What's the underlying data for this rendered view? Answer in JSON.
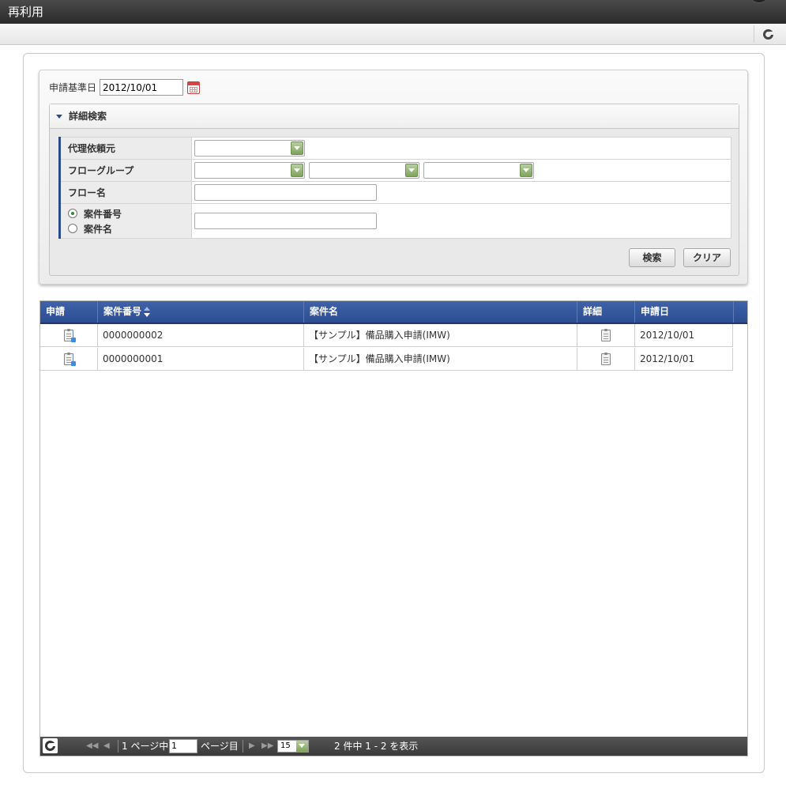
{
  "window": {
    "title": "再利用"
  },
  "search": {
    "date_label": "申請基準日",
    "date_value": "2012/10/01",
    "detail_title": "詳細検索",
    "rows": {
      "proxy_label": "代理依頼元",
      "flow_group_label": "フローグループ",
      "flow_name_label": "フロー名",
      "matter_number_label": "案件番号",
      "matter_name_label": "案件名"
    },
    "search_button": "検索",
    "clear_button": "クリア"
  },
  "grid": {
    "columns": [
      "申請",
      "案件番号",
      "案件名",
      "詳細",
      "申請日"
    ],
    "rows": [
      {
        "number": "0000000002",
        "name": "【サンプル】備品購入申請(IMW)",
        "date": "2012/10/01"
      },
      {
        "number": "0000000001",
        "name": "【サンプル】備品購入申請(IMW)",
        "date": "2012/10/01"
      }
    ]
  },
  "pager": {
    "page_prefix": "1 ページ中",
    "page_value": "1",
    "page_suffix": "ページ目",
    "rows_per_page": "15",
    "summary": "2 件中 1 - 2 を表示"
  },
  "icons": {
    "refresh": "refresh-icon",
    "calendar": "calendar-icon",
    "apply": "apply-document-icon",
    "detail": "clipboard-icon"
  }
}
